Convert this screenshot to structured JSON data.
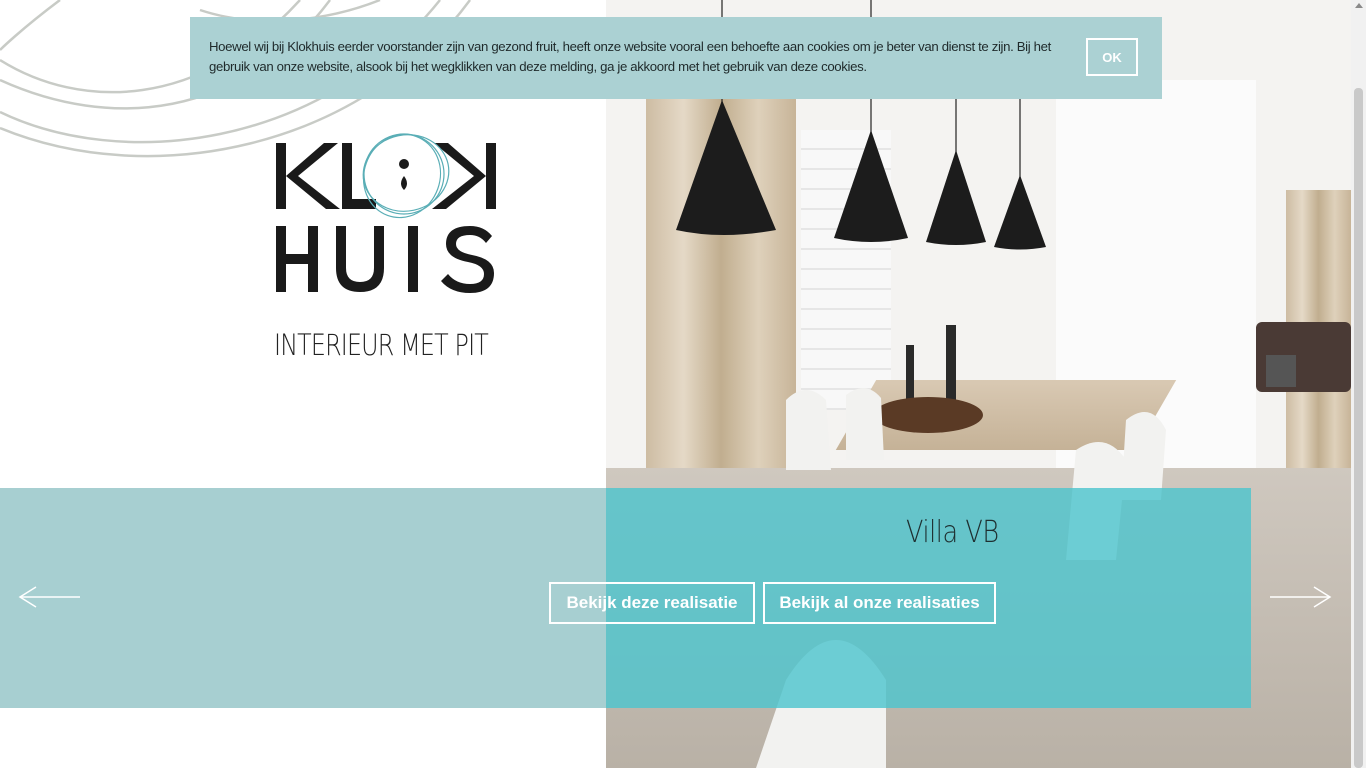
{
  "brand": {
    "logo_line1": "KLOK",
    "logo_line2": "HUIS",
    "tagline": "INTERIEUR MET PIT"
  },
  "cookie_banner": {
    "text": "Hoewel wij bij Klokhuis eerder voorstander zijn van gezond fruit, heeft onze website vooral een behoefte aan cookies om je beter van dienst te zijn. Bij het gebruik van onze website, alsook bij het wegklikken van deze melding, ga je akkoord met het gebruik van deze cookies.",
    "ok_label": "OK"
  },
  "slider": {
    "title": "Villa VB",
    "button_view_project": "Bekijk deze realisatie",
    "button_view_all": "Bekijk al onze realisaties",
    "prev_icon": "arrow-left-icon",
    "next_icon": "arrow-right-icon"
  },
  "colors": {
    "banner_bg": "#abd1d3",
    "band_left": "#a7cfd1",
    "band_right": "#4ec4cd",
    "logo_ring": "#5aaeb6",
    "text_dark": "#222222"
  }
}
